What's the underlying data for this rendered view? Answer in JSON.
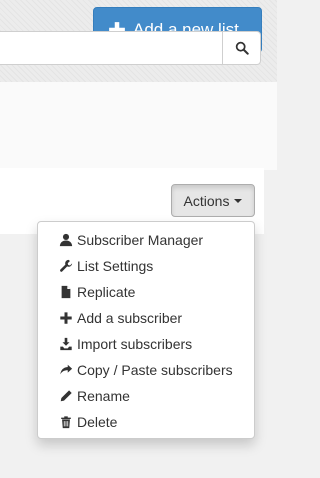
{
  "header": {
    "add_list_label": "Add a new list",
    "add_list_icon": "plus-icon",
    "accent_color": "#428bca"
  },
  "search": {
    "value": "",
    "placeholder": "",
    "button_icon": "search-icon"
  },
  "actions": {
    "label": "Actions",
    "caret_icon": "caret-down-icon"
  },
  "menu": {
    "items": [
      {
        "label": "Subscriber Manager",
        "icon": "user-icon"
      },
      {
        "label": "List Settings",
        "icon": "wrench-icon"
      },
      {
        "label": "Replicate",
        "icon": "file-icon"
      },
      {
        "label": "Add a subscriber",
        "icon": "plus-icon"
      },
      {
        "label": "Import subscribers",
        "icon": "import-icon"
      },
      {
        "label": "Copy / Paste subscribers",
        "icon": "share-icon"
      },
      {
        "label": "Rename",
        "icon": "pencil-icon"
      },
      {
        "label": "Delete",
        "icon": "trash-icon"
      }
    ]
  }
}
